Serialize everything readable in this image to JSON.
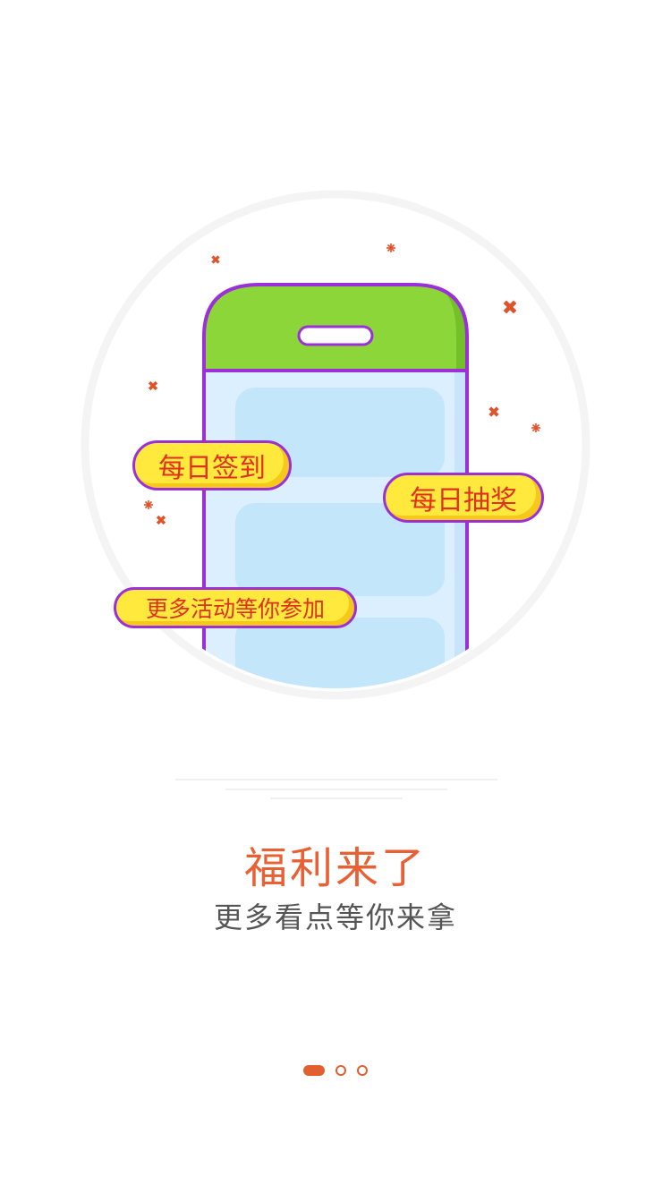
{
  "illustration": {
    "bubbles": {
      "daily_signin": "每日签到",
      "daily_lottery": "每日抽奖",
      "more_activities": "更多活动等你参加"
    },
    "colors": {
      "phone_outline": "#9b30d9",
      "phone_top": "#8cd63a",
      "phone_screen": "#dcefff",
      "card": "#c3e6fb",
      "bubble_fill": "#ffe93d",
      "bubble_text": "#e0301e",
      "sparkle": "#e0522a"
    }
  },
  "main": {
    "title": "福利来了",
    "subtitle": "更多看点等你来拿"
  },
  "pager": {
    "total": 3,
    "current": 1,
    "accent": "#e0602f"
  }
}
